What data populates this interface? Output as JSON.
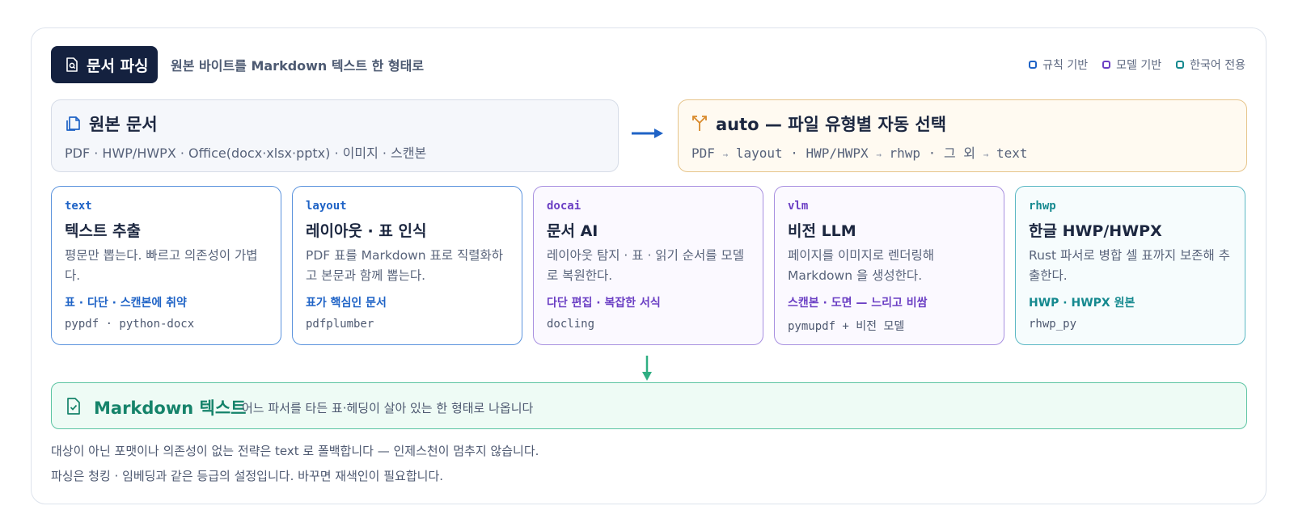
{
  "header": {
    "title": "문서 파싱",
    "subtitle": "원본 바이트를 Markdown 텍스트 한 형태로",
    "title_icon": "document-search-icon"
  },
  "legend": [
    {
      "label": "규칙 기반",
      "color": "#1f63c6"
    },
    {
      "label": "모델 기반",
      "color": "#6b3fc4"
    },
    {
      "label": "한국어 전용",
      "color": "#15898f"
    }
  ],
  "source": {
    "icon": "copy-documents-icon",
    "title": "원본 문서",
    "formats": "PDF · HWP/HWPX · Office(docx·xlsx·pptx) · 이미지 · 스캔본"
  },
  "auto": {
    "icon": "split-arrows-icon",
    "title": "auto — 파일 유형별 자동 선택",
    "rules": [
      {
        "from": "PDF",
        "to": "layout"
      },
      {
        "from": "HWP/HWPX",
        "to": "rhwp"
      },
      {
        "from": "그 외",
        "to": "text"
      }
    ],
    "arrow": "→",
    "separator": "·"
  },
  "strategies": [
    {
      "code": "text",
      "name": "텍스트 추출",
      "desc": "평문만 뽑는다. 빠르고 의존성이 가볍다.",
      "tag": "표 · 다단 · 스캔본에 취약",
      "lib": "pypdf · python-docx",
      "kind": "rule"
    },
    {
      "code": "layout",
      "name": "레이아웃 · 표 인식",
      "desc": "PDF 표를 Markdown 표로 직렬화하고 본문과 함께 뽑는다.",
      "tag": "표가 핵심인 문서",
      "lib": "pdfplumber",
      "kind": "rule"
    },
    {
      "code": "docai",
      "name": "문서 AI",
      "desc": "레이아웃 탐지 · 표 · 읽기 순서를 모델로 복원한다.",
      "tag": "다단 편집 · 복잡한 서식",
      "lib": "docling",
      "kind": "model"
    },
    {
      "code": "vlm",
      "name": "비전 LLM",
      "desc": "페이지를 이미지로 렌더링해 Markdown 을 생성한다.",
      "tag": "스캔본 · 도면 — 느리고 비쌈",
      "lib": "pymupdf + 비전 모델",
      "kind": "model"
    },
    {
      "code": "rhwp",
      "name": "한글 HWP/HWPX",
      "desc": "Rust 파서로 병합 셀 표까지 보존해 추출한다.",
      "tag": "HWP · HWPX 원본",
      "lib": "rhwp_py",
      "kind": "korean"
    }
  ],
  "output": {
    "icon": "document-check-icon",
    "title": "Markdown 텍스트",
    "desc": "어느 파서를 타든 표·헤딩이 살아 있는 한 형태로 나옵니다"
  },
  "notes": [
    "대상이 아닌 포맷이나 의존성이 없는 전략은 text 로 폴백합니다 — 인제스천이 멈추지 않습니다.",
    "파싱은 청킹 · 임베딩과 같은 등급의 설정입니다. 바꾸면 재색인이 필요합니다."
  ]
}
